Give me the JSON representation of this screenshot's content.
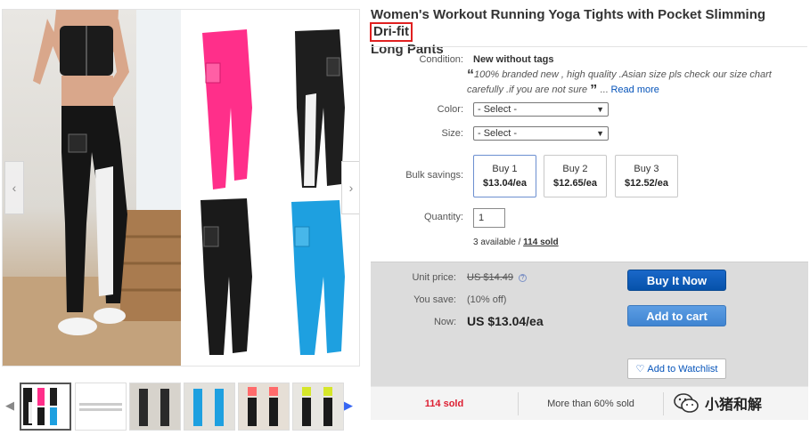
{
  "title": {
    "main": "Women's Workout Running Yoga Tights with Pocket Slimming",
    "highlight": "Dri-fit",
    "rest": "Long Pants"
  },
  "condition": {
    "label": "Condition:",
    "value": "New without tags",
    "quote": "100% branded new , high quality .Asian size pls check our size chart carefully .if you are not sure",
    "read_more": "Read more"
  },
  "color": {
    "label": "Color:",
    "value": "- Select -"
  },
  "size": {
    "label": "Size:",
    "value": "- Select -"
  },
  "bulk": {
    "label": "Bulk savings:",
    "options": [
      {
        "qty": "Buy 1",
        "price": "$13.04/ea"
      },
      {
        "qty": "Buy 2",
        "price": "$12.65/ea"
      },
      {
        "qty": "Buy 3",
        "price": "$12.52/ea"
      }
    ]
  },
  "quantity": {
    "label": "Quantity:",
    "value": "1",
    "available": "3 available /",
    "sold": "114 sold"
  },
  "pricing": {
    "unit_label": "Unit price:",
    "unit_value": "US $14.49",
    "save_label": "You save:",
    "save_value": "(10% off)",
    "now_label": "Now:",
    "now_value": "US $13.04/ea"
  },
  "buttons": {
    "buy_now": "Buy It Now",
    "add_to_cart": "Add to cart",
    "watchlist": "Add to Watchlist"
  },
  "stats": {
    "sold": "114 sold",
    "pct": "More than 60% sold"
  },
  "watermark": "小猪和解",
  "colors": {
    "accent_blue": "#0654ba",
    "buy_blue": "#0652aa",
    "cart_blue": "#3f84d1",
    "sold_red": "#dd1e31",
    "highlight_red": "#e02020",
    "pink": "#ff2f8a",
    "cyan": "#1ea0e0"
  }
}
